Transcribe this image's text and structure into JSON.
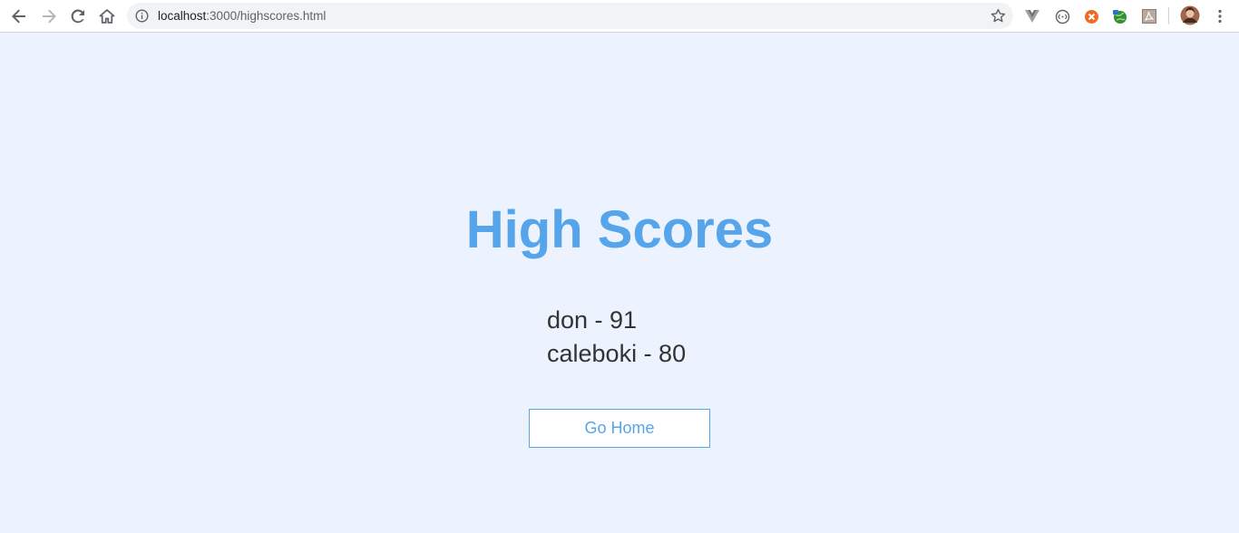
{
  "browser": {
    "url_host": "localhost",
    "url_rest": ":3000/highscores.html",
    "icons": [
      "back-icon",
      "forward-icon",
      "reload-icon",
      "home-icon",
      "site-info-icon",
      "bookmark-star-icon",
      "vuejs-devtools-icon",
      "extension-circle-icon",
      "extension-orange-icon",
      "extension-globe-icon",
      "pdf-extension-icon",
      "profile-avatar",
      "menu-kebab-icon"
    ]
  },
  "page": {
    "title": "High Scores",
    "scores": [
      {
        "text": "don - 91"
      },
      {
        "text": "caleboki - 80"
      }
    ],
    "home_button": "Go Home"
  },
  "colors": {
    "background": "#ecf3fe",
    "accent": "#56a5eb",
    "text": "#333333"
  }
}
